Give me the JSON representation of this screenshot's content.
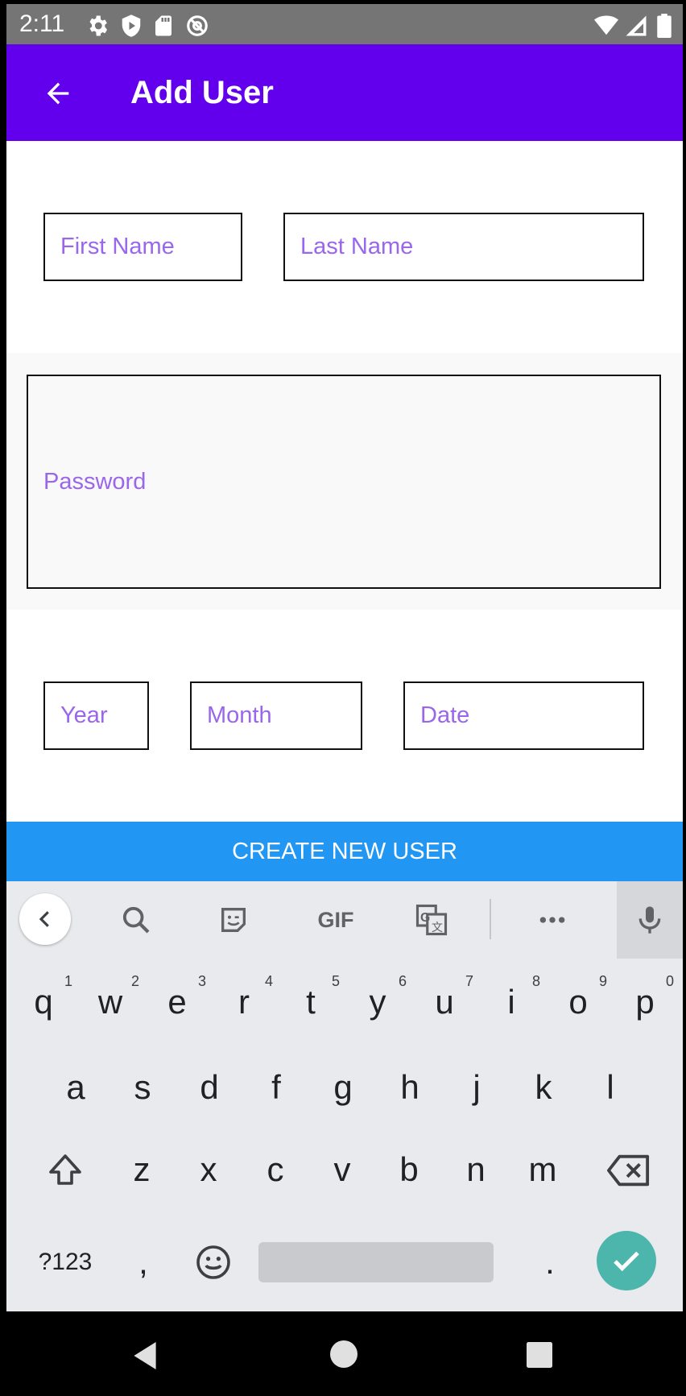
{
  "status_bar": {
    "time": "2:11",
    "icons": [
      "gear-icon",
      "shield-icon",
      "sd-card-icon",
      "at-icon",
      "wifi-icon",
      "signal-icon",
      "battery-icon"
    ]
  },
  "app_bar": {
    "title": "Add User",
    "color": "#6200EE"
  },
  "form": {
    "first_name_placeholder": "First Name",
    "last_name_placeholder": "Last Name",
    "password_placeholder": "Password",
    "year_placeholder": "Year",
    "month_placeholder": "Month",
    "date_placeholder": "Date",
    "placeholder_color": "#9a66ea"
  },
  "create_button": {
    "label": "CREATE NEW USER",
    "color": "#2196F3"
  },
  "keyboard": {
    "toolbar": [
      "chevron-left-icon",
      "search-icon",
      "sticker-icon",
      "gif-label",
      "translate-icon",
      "more-icon",
      "mic-icon"
    ],
    "gif_label": "GIF",
    "row1": [
      {
        "key": "q",
        "hint": "1"
      },
      {
        "key": "w",
        "hint": "2"
      },
      {
        "key": "e",
        "hint": "3"
      },
      {
        "key": "r",
        "hint": "4"
      },
      {
        "key": "t",
        "hint": "5"
      },
      {
        "key": "y",
        "hint": "6"
      },
      {
        "key": "u",
        "hint": "7"
      },
      {
        "key": "i",
        "hint": "8"
      },
      {
        "key": "o",
        "hint": "9"
      },
      {
        "key": "p",
        "hint": "0"
      }
    ],
    "row2": [
      "a",
      "s",
      "d",
      "f",
      "g",
      "h",
      "j",
      "k",
      "l"
    ],
    "row3": [
      "z",
      "x",
      "c",
      "v",
      "b",
      "n",
      "m"
    ],
    "symbols_label": "?123",
    "comma": ",",
    "period": "."
  }
}
